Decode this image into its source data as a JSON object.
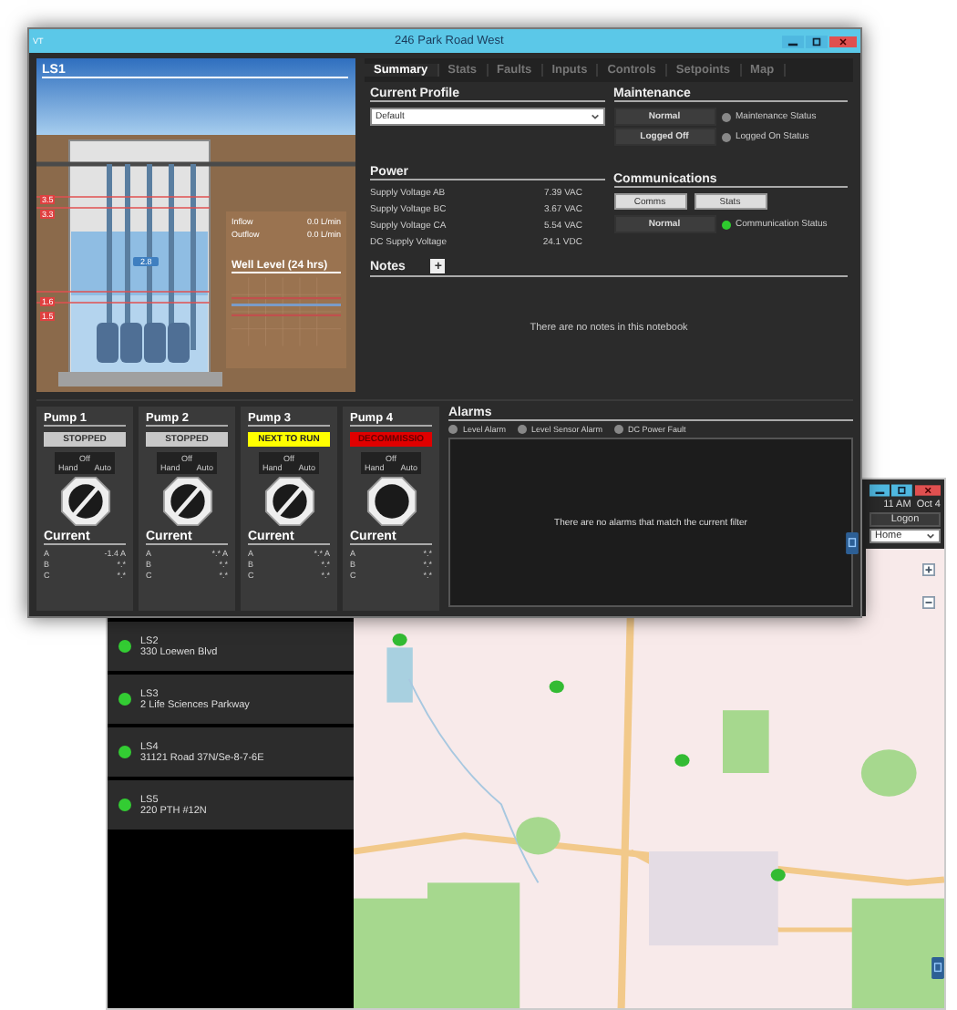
{
  "main_window": {
    "app_label": "VT",
    "title": "246 Park Road West"
  },
  "station": {
    "name": "LS1",
    "level_marks": [
      "3.5",
      "3.3",
      "1.6",
      "1.5"
    ],
    "level_reading": "2.8",
    "flows": [
      {
        "label": "Inflow",
        "value": "0.0 L/min"
      },
      {
        "label": "Outflow",
        "value": "0.0 L/min"
      }
    ],
    "chart_title": "Well Level (24 hrs)"
  },
  "tabs": [
    {
      "label": "Summary",
      "selected": true
    },
    {
      "label": "Stats",
      "selected": false
    },
    {
      "label": "Faults",
      "selected": false
    },
    {
      "label": "Inputs",
      "selected": false
    },
    {
      "label": "Controls",
      "selected": false
    },
    {
      "label": "Setpoints",
      "selected": false
    },
    {
      "label": "Map",
      "selected": false
    }
  ],
  "current_profile": {
    "heading": "Current Profile",
    "value": "Default"
  },
  "maintenance": {
    "heading": "Maintenance",
    "rows": [
      {
        "button": "Normal",
        "status": "Maintenance Status",
        "on": false
      },
      {
        "button": "Logged Off",
        "status": "Logged On Status",
        "on": false
      }
    ]
  },
  "power": {
    "heading": "Power",
    "rows": [
      {
        "label": "Supply Voltage AB",
        "value": "7.39 VAC"
      },
      {
        "label": "Supply Voltage BC",
        "value": "3.67 VAC"
      },
      {
        "label": "Supply Voltage CA",
        "value": "5.54 VAC"
      },
      {
        "label": "DC Supply Voltage",
        "value": "24.1 VDC"
      }
    ]
  },
  "communications": {
    "heading": "Communications",
    "buttons": [
      "Comms",
      "Stats"
    ],
    "status_button": "Normal",
    "status_label": "Communication Status",
    "on": true
  },
  "notes": {
    "heading": "Notes",
    "add": "+",
    "empty_message": "There are no notes in this notebook"
  },
  "pumps": [
    {
      "name": "Pump 1",
      "state": "STOPPED",
      "kind": "stopped",
      "switch_labels": [
        "Off",
        "Hand",
        "Auto"
      ],
      "switch_set": true,
      "current_heading": "Current",
      "readings": [
        {
          "phase": "A",
          "value": "-1.4 A"
        },
        {
          "phase": "B",
          "value": "*.*"
        },
        {
          "phase": "C",
          "value": "*.*"
        }
      ]
    },
    {
      "name": "Pump 2",
      "state": "STOPPED",
      "kind": "stopped",
      "switch_labels": [
        "Off",
        "Hand",
        "Auto"
      ],
      "switch_set": true,
      "current_heading": "Current",
      "readings": [
        {
          "phase": "A",
          "value": "*.* A"
        },
        {
          "phase": "B",
          "value": "*.*"
        },
        {
          "phase": "C",
          "value": "*.*"
        }
      ]
    },
    {
      "name": "Pump 3",
      "state": "NEXT TO RUN",
      "kind": "next",
      "switch_labels": [
        "Off",
        "Hand",
        "Auto"
      ],
      "switch_set": true,
      "current_heading": "Current",
      "readings": [
        {
          "phase": "A",
          "value": "*.* A"
        },
        {
          "phase": "B",
          "value": "*.*"
        },
        {
          "phase": "C",
          "value": "*.*"
        }
      ]
    },
    {
      "name": "Pump 4",
      "state": "DECOMMISSIO",
      "kind": "decommissioned",
      "switch_labels": [
        "Off",
        "Hand",
        "Auto"
      ],
      "switch_set": false,
      "current_heading": "Current",
      "readings": [
        {
          "phase": "A",
          "value": "*.*"
        },
        {
          "phase": "B",
          "value": "*.*"
        },
        {
          "phase": "C",
          "value": "*.*"
        }
      ]
    }
  ],
  "alarms": {
    "heading": "Alarms",
    "filters": [
      {
        "label": "Level Alarm",
        "active": false
      },
      {
        "label": "Level Sensor Alarm",
        "active": false
      },
      {
        "label": "DC Power Fault",
        "active": false
      }
    ],
    "empty_message": "There are no alarms that match the current filter"
  },
  "back_window": {
    "clock": "11 AM  Oct 4",
    "logon": "Logon",
    "view": "Home",
    "stations": [
      {
        "name": "LS2",
        "address": "330 Loewen Blvd",
        "color": "#33cc33"
      },
      {
        "name": "LS3",
        "address": "2 Life Sciences Parkway",
        "color": "#33cc33"
      },
      {
        "name": "LS4",
        "address": "31121 Road 37N/Se-8-7-6E",
        "color": "#33cc33"
      },
      {
        "name": "LS5",
        "address": "220 PTH #12N",
        "color": "#33cc33"
      }
    ]
  }
}
